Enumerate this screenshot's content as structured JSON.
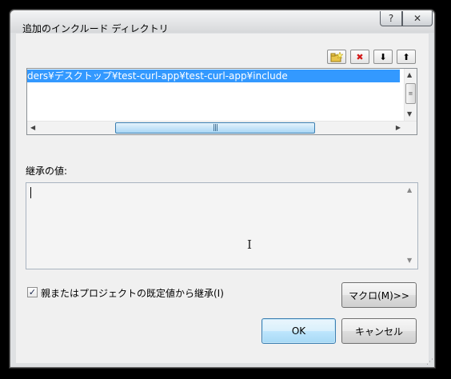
{
  "window": {
    "title": "追加のインクルード ディレクトリ",
    "help": "?",
    "close": "✕"
  },
  "toolbar": {
    "new_line_icon": "new-folder-icon",
    "delete_icon": "delete-icon",
    "move_down_icon": "arrow-down-icon",
    "move_up_icon": "arrow-up-icon",
    "delete_glyph": "✖",
    "down_glyph": "⬇",
    "up_glyph": "⬆"
  },
  "directories": {
    "items": [
      "ders¥デスクトップ¥test-curl-app¥test-curl-app¥include"
    ],
    "selected_color": "#3399ff"
  },
  "inherited": {
    "label": "継承の値:",
    "value": ""
  },
  "options": {
    "inherit_label": "親またはプロジェクトの既定値から継承(I)",
    "inherit_checked": true
  },
  "buttons": {
    "macro": "マクロ(M)>>",
    "ok": "OK",
    "cancel": "キャンセル"
  }
}
